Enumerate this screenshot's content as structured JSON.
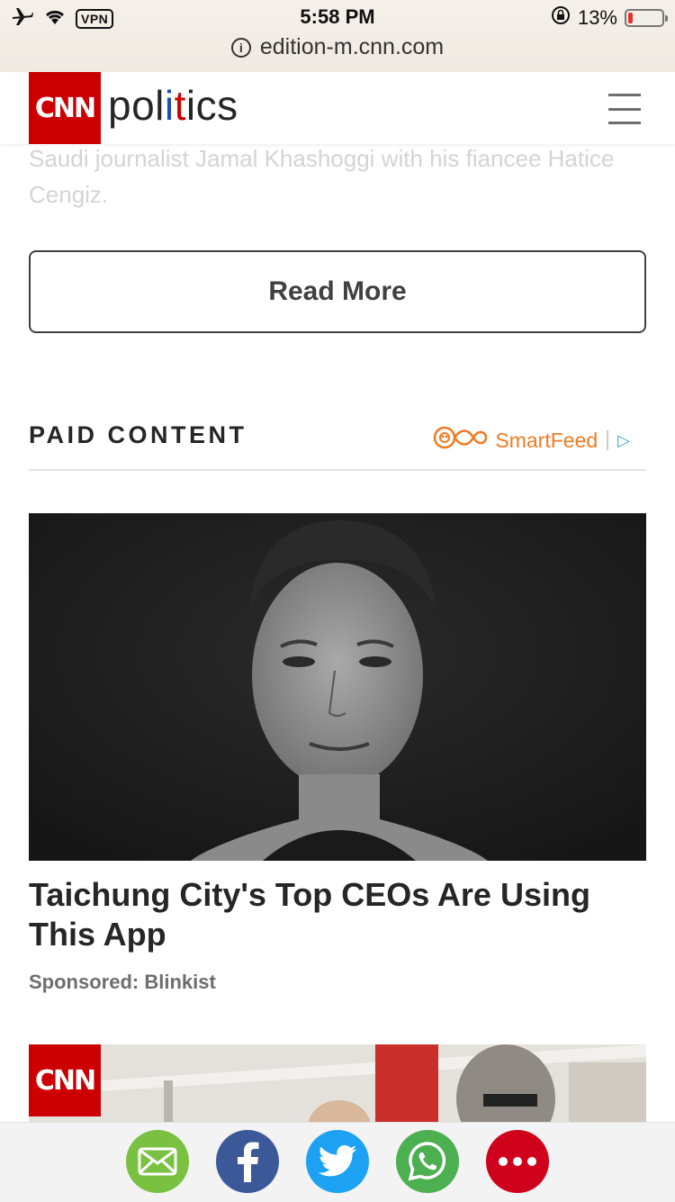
{
  "status_bar": {
    "vpn_label": "VPN",
    "time": "5:58 PM",
    "battery_percent": "13%",
    "battery_level": 0.13
  },
  "browser": {
    "url": "edition-m.cnn.com"
  },
  "header": {
    "logo_text": "CNN",
    "section_letters": [
      "pol",
      "i",
      "t",
      "i",
      "cs"
    ],
    "section_colors": [
      "#262626",
      "#1a4fb5",
      "#cc0000",
      "#262626",
      "#262626"
    ]
  },
  "article": {
    "caption_tail": "Saudi journalist Jamal Khashoggi with his fiancee Hatice Cengiz.",
    "read_more_label": "Read More"
  },
  "paid_content": {
    "title": "PAID CONTENT",
    "provider": "SmartFeed",
    "cards": [
      {
        "title": "Taichung City's Top CEOs Are Using This App",
        "sponsor": "Sponsored: Blinkist"
      }
    ],
    "second_card_badge": "CNN"
  },
  "share_bar": {
    "buttons": [
      {
        "name": "email",
        "color": "#7ac142"
      },
      {
        "name": "facebook",
        "color": "#3b5998"
      },
      {
        "name": "twitter",
        "color": "#1da1f2"
      },
      {
        "name": "whatsapp",
        "color": "#4caf50"
      },
      {
        "name": "more",
        "color": "#d0021b"
      }
    ]
  }
}
